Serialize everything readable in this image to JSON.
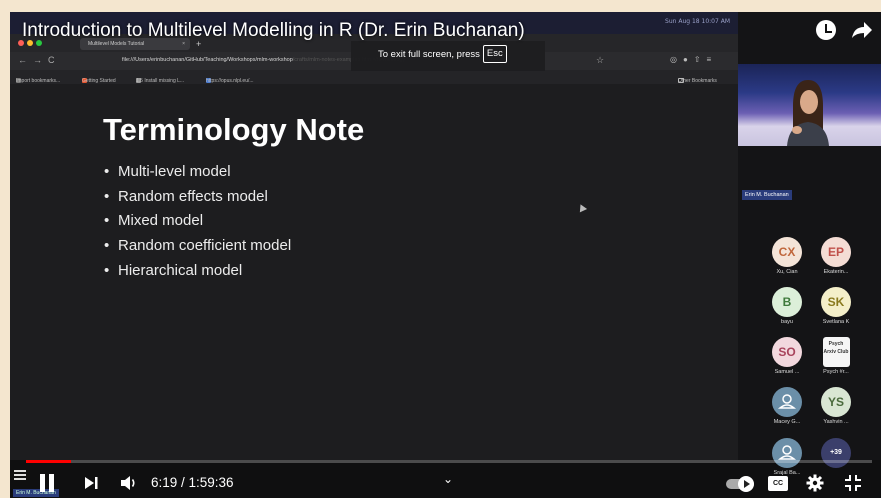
{
  "video": {
    "title": "Introduction to Multilevel Modelling in R (Dr. Erin Buchanan)"
  },
  "fullscreen_hint": {
    "text": "To exit full screen, press",
    "key": "Esc"
  },
  "browser": {
    "status_text": "Sun Aug 18 10:07 AM",
    "tab_title": "Multilevel Models Tutorial",
    "url_visible": "file:///Users/erinbuchanan/GitHub/Teaching/Workshops/mlm-workshop",
    "url_faded": "/crafts/mlm-notes-examples.html#/terminology",
    "bookmarks": [
      "Import bookmarks...",
      "Getting Started",
      "1.5 Install missing L...",
      "https://opus.nlpl.eu/..."
    ],
    "other_bookmarks": "Other Bookmarks"
  },
  "slide": {
    "title": "Terminology Note",
    "bullets": [
      "Multi-level model",
      "Random effects model",
      "Mixed model",
      "Random coefficient model",
      "Hierarchical model"
    ]
  },
  "speaker": {
    "name": "Erin M. Buchanan"
  },
  "participants": [
    {
      "initials": "CX",
      "name": "Xu, Cian",
      "color": "#f4e4d8",
      "text_color": "#c0673c"
    },
    {
      "initials": "EP",
      "name": "Ekaterin...",
      "color": "#f4dcd4",
      "text_color": "#c0504a"
    },
    {
      "initials": "B",
      "name": "bayu",
      "color": "#dcefd9",
      "text_color": "#3f7a3c"
    },
    {
      "initials": "SK",
      "name": "Svetlana K",
      "color": "#f4efc9",
      "text_color": "#8a7a1e"
    },
    {
      "initials": "SO",
      "name": "Samuel ...",
      "color": "#f2d8de",
      "text_color": "#a8435c"
    },
    {
      "initials": "Psych Arxiv Club",
      "name": "Psych #r...",
      "color": "#f5f5f5",
      "text_color": "#333333"
    },
    {
      "initials": "",
      "name": "Macey G...",
      "color": "#6b8fa8",
      "text_color": "#ffffff"
    },
    {
      "initials": "YS",
      "name": "Yashvin ...",
      "color": "#d9e6d3",
      "text_color": "#4a6a3c"
    },
    {
      "initials": "",
      "name": "Srajal Ba...",
      "color": "#6b8fa8",
      "text_color": "#ffffff"
    },
    {
      "initials": "+39",
      "name": "",
      "color": "#3b3f6b",
      "text_color": "#ffffff"
    }
  ],
  "player": {
    "current_time": "6:19",
    "duration": "1:59:36",
    "time_display": "6:19 / 1:59:36",
    "progress_fraction": 0.053,
    "cc_label": "CC",
    "mini_name": "Erin M. Buchanan"
  },
  "colors": {
    "progress": "#ff0000",
    "page_background": "#f4e6cf",
    "name_tag": "#2a3c7b"
  }
}
